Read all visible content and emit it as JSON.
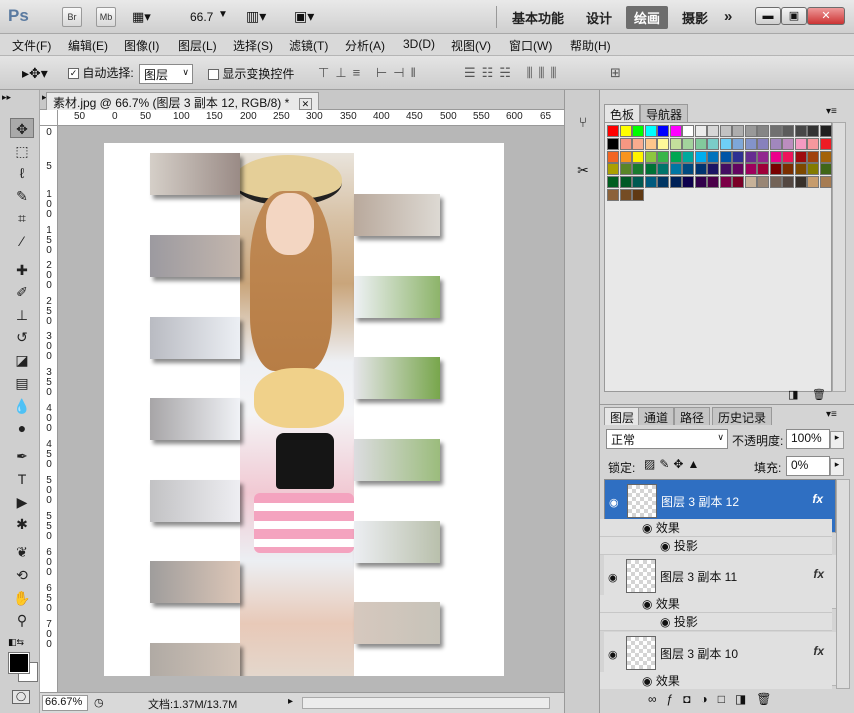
{
  "titlebar": {
    "logo": "Ps",
    "br": "Br",
    "mb": "Mb",
    "zoom": "66.7",
    "workspaces": [
      "基本功能",
      "设计",
      "绘画",
      "摄影"
    ],
    "more": "»"
  },
  "menu": [
    "文件(F)",
    "编辑(E)",
    "图像(I)",
    "图层(L)",
    "选择(S)",
    "滤镜(T)",
    "分析(A)",
    "3D(D)",
    "视图(V)",
    "窗口(W)",
    "帮助(H)"
  ],
  "options": {
    "auto_select_label": "自动选择:",
    "auto_select_value": "图层",
    "transform_label": "显示变换控件"
  },
  "document": {
    "tab_title": "素材.jpg @ 66.7% (图层 3 副本 12, RGB/8) *",
    "close": "✕"
  },
  "ruler": {
    "h": [
      "50",
      "0",
      "50",
      "100",
      "150",
      "200",
      "250",
      "300",
      "350",
      "400",
      "450",
      "500",
      "550",
      "600",
      "65"
    ],
    "v": [
      "0",
      "5",
      "1 0 0",
      "1 5 0",
      "2 0 0",
      "2 5 0",
      "3 0 0",
      "3 5 0",
      "4 0 0",
      "4 5 0",
      "5 0 0",
      "5 5 0",
      "6 0 0",
      "6 5 0",
      "7 0 0"
    ]
  },
  "status": {
    "zoom": "66.67%",
    "doc": "文档:1.37M/13.7M"
  },
  "swatches": {
    "tabs": [
      "色板",
      "导航器"
    ]
  },
  "layers": {
    "tabs": [
      "图层",
      "通道",
      "路径",
      "历史记录"
    ],
    "blend": "正常",
    "opacity_label": "不透明度:",
    "opacity": "100%",
    "lock_label": "锁定:",
    "fill_label": "填充:",
    "fill": "0%",
    "items": [
      {
        "name": "图层 3 副本 12"
      },
      {
        "name": "图层 3 副本 11"
      },
      {
        "name": "图层 3 副本 10"
      }
    ],
    "effects_label": "效果",
    "shadow_label": "投影",
    "fx": "fx"
  },
  "colors": {
    "accent": "#2f6fc2"
  }
}
